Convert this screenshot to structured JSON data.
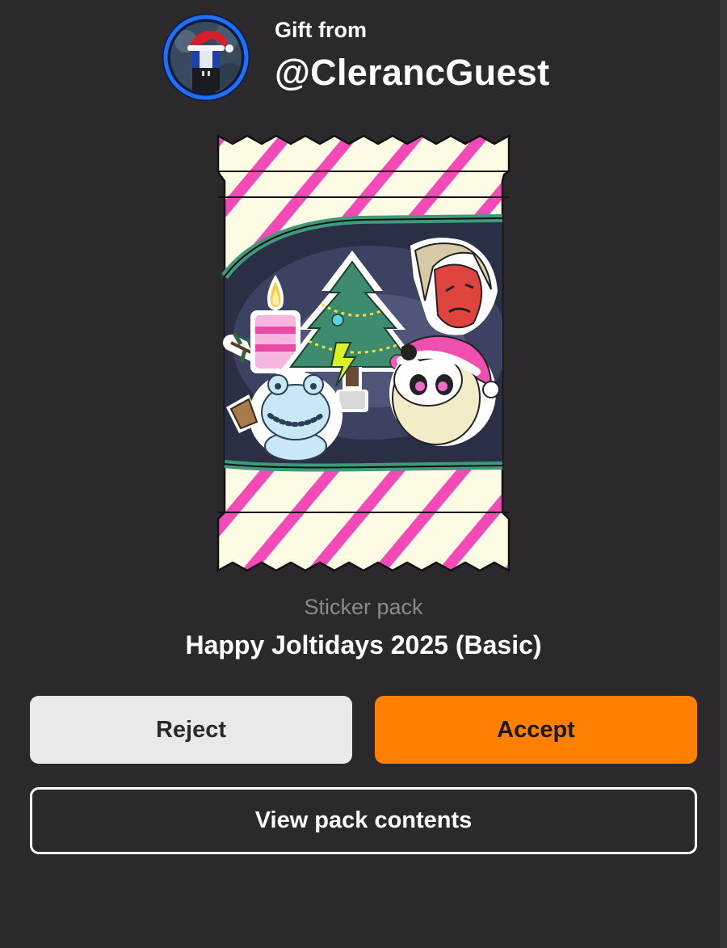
{
  "gift": {
    "label": "Gift from",
    "sender": "@ClerancGuest"
  },
  "pack": {
    "type": "Sticker pack",
    "name": "Happy Joltidays 2025 (Basic)"
  },
  "actions": {
    "reject_label": "Reject",
    "accept_label": "Accept",
    "view_label": "View pack contents"
  },
  "colors": {
    "background": "#2b292c",
    "accept": "#ff8000",
    "reject": "#ebe8ec",
    "wrapper_stripe": "#f44ab8",
    "wrapper_base": "#fdfbe3",
    "window_band": "#3e9a7b"
  },
  "icons": {
    "avatar": "santa-hat-avatar",
    "stickers": [
      "candle-icon",
      "christmas-tree-icon",
      "red-face-icon",
      "frog-snowman-icon",
      "panda-santa-icon",
      "pine-branch-icon",
      "lightning-bolt-icon"
    ]
  }
}
